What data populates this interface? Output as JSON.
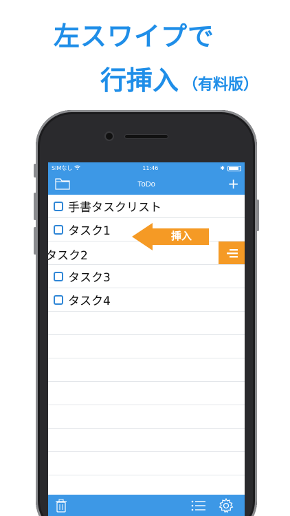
{
  "promo": {
    "headline_line1": "左スワイプで",
    "headline_line2": "行挿入",
    "headline_note": "（有料版）"
  },
  "status_bar": {
    "carrier": "SIMなし",
    "time": "11:46",
    "battery_level": 0.9
  },
  "nav": {
    "title": "ToDo",
    "left_icon": "folder-icon",
    "right_icon": "plus-icon",
    "plus_symbol": "+"
  },
  "list": {
    "items": [
      {
        "text": "手書タスクリスト",
        "checkbox": true
      },
      {
        "text": "タスク1",
        "checkbox": true
      },
      {
        "text": "タスク2",
        "checkbox": false,
        "swiped": true
      },
      {
        "text": "タスク3",
        "checkbox": true
      },
      {
        "text": "タスク4",
        "checkbox": true
      }
    ]
  },
  "swipe": {
    "arrow_label": "挿入",
    "action_icon": "insert-row-icon"
  },
  "toolbar": {
    "left_icon": "trash-icon",
    "icons": [
      "list-icon",
      "gear-icon"
    ]
  },
  "colors": {
    "accent": "#3d98e6",
    "headline": "#1f8ee8",
    "swipe_action": "#f59a25"
  }
}
